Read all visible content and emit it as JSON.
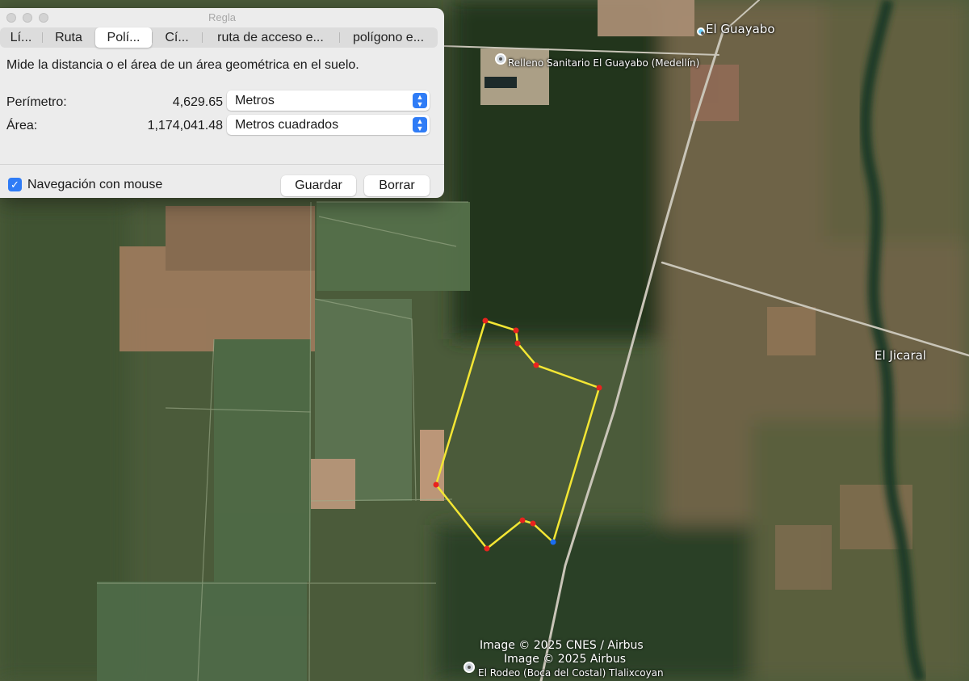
{
  "map": {
    "places": [
      {
        "name": "El Guayabo"
      },
      {
        "name": "Relleno Sanitario El Guayabo (Medellín)"
      },
      {
        "name": "El Jicaral"
      },
      {
        "name": "El Rodeo (Boca del Costal) Tlalixcoyan"
      }
    ],
    "attribution": [
      "Image © 2025 CNES / Airbus",
      "Image © 2025 Airbus"
    ],
    "polygon_color": "#f3e634",
    "vertex_color": "#e8231e",
    "active_vertex_color": "#1a6df0"
  },
  "ruler": {
    "title": "Regla",
    "tabs": [
      {
        "label": "Lí...",
        "active": false
      },
      {
        "label": "Ruta",
        "active": false
      },
      {
        "label": "Polí...",
        "active": true
      },
      {
        "label": "Cí...",
        "active": false
      },
      {
        "label": "ruta de acceso e...",
        "active": false
      },
      {
        "label": "polígono e...",
        "active": false
      }
    ],
    "description": "Mide la distancia o el área de un área geométrica en el suelo.",
    "perimeter": {
      "label": "Perímetro:",
      "value": "4,629.65",
      "unit": "Metros"
    },
    "area": {
      "label": "Área:",
      "value": "1,174,041.48",
      "unit": "Metros cuadrados"
    },
    "mouse_nav": {
      "label": "Navegación con mouse",
      "checked": true
    },
    "save_label": "Guardar",
    "clear_label": "Borrar",
    "accent_color": "#2f7cf6"
  }
}
